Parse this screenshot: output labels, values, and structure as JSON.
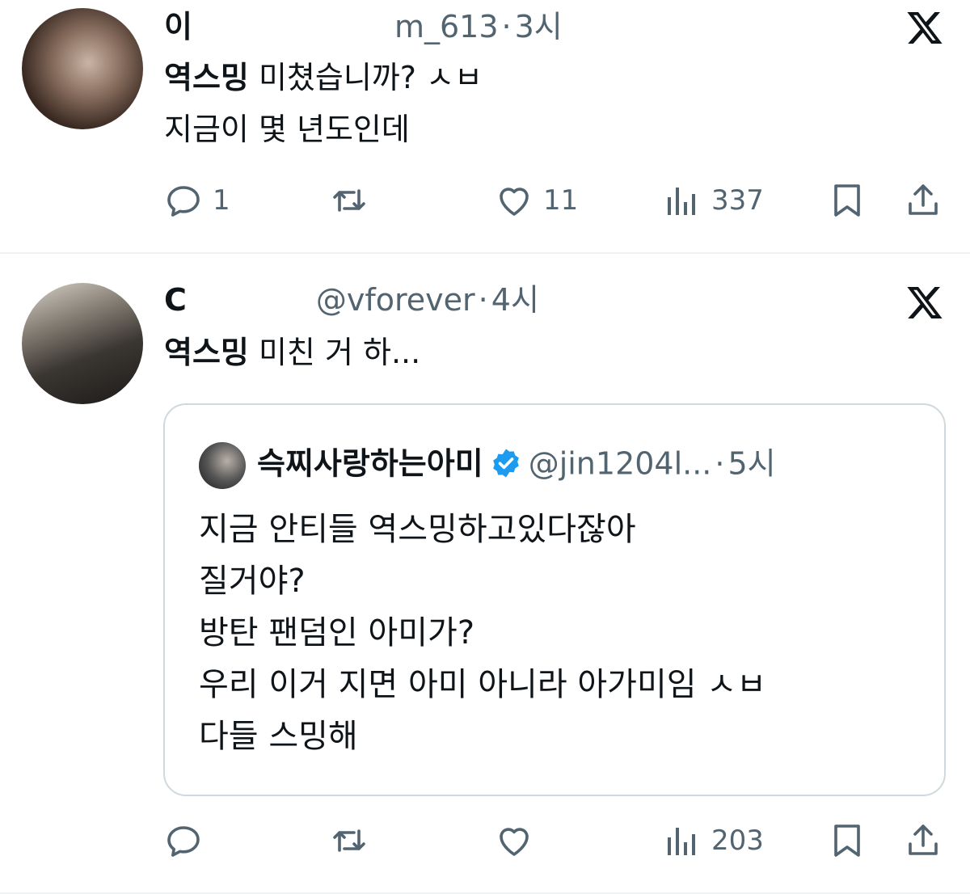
{
  "tweets": [
    {
      "name": "이",
      "handle": "m_613",
      "time": "3시",
      "body_bold": "역스밍",
      "body_rest": " 미쳤습니까? ㅅㅂ",
      "body_line2": "지금이 몇 년도인데",
      "reply_count": "1",
      "retweet_count": "",
      "like_count": "11",
      "view_count": "337"
    },
    {
      "name": "C",
      "handle": "@vforever",
      "time": "4시",
      "body_bold": "역스밍",
      "body_rest": " 미친 거 하...",
      "reply_count": "",
      "retweet_count": "",
      "like_count": "",
      "view_count": "203",
      "quote": {
        "name": "슥찌사랑하는아미",
        "handle": "@jin1204l...",
        "time": "5시",
        "text": "지금 안티들 역스밍하고있다잖아\n질거야?\n방탄 팬덤인 아미가?\n우리 이거 지면 아미 아니라 아가미임 ㅅㅂ\n다들 스밍해"
      }
    }
  ],
  "icons": {
    "platform": "x-logo-icon",
    "reply": "reply-icon",
    "retweet": "retweet-icon",
    "like": "heart-icon",
    "views": "views-icon",
    "bookmark": "bookmark-icon",
    "share": "share-icon",
    "verified": "verified-badge-icon"
  },
  "colors": {
    "text": "#0f1419",
    "muted": "#536471",
    "verified": "#1d9bf0",
    "border": "#cfd9de"
  }
}
